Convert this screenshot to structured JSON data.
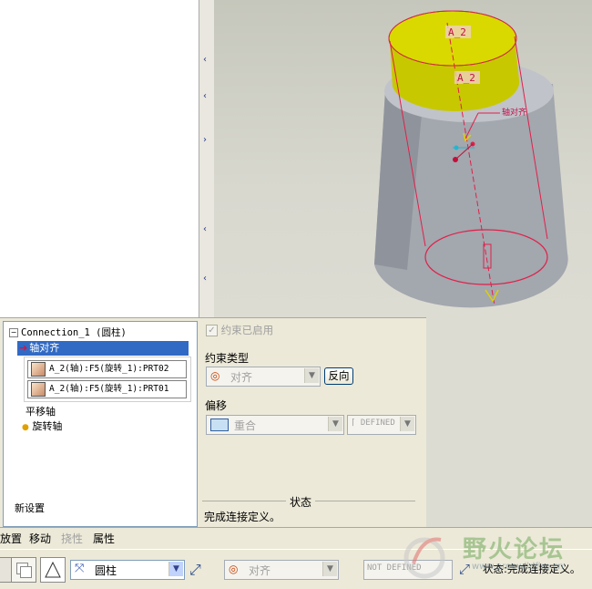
{
  "viewport": {
    "axis_label_top": "A_2",
    "axis_label_mid": "A_2",
    "constraint_label": "轴对齐"
  },
  "tree": {
    "connection": "Connection_1 (圆柱)",
    "axis_align": "轴对齐",
    "ref1": "A_2(轴):F5(旋转_1):PRT02",
    "ref2": "A_2(轴):F5(旋转_1):PRT01",
    "translate_axis": "平移轴",
    "rotate_axis": "旋转轴",
    "new_set": "新设置"
  },
  "props": {
    "enabled_label": "约束已启用",
    "type_label": "约束类型",
    "type_value": "对齐",
    "flip_button": "反向",
    "offset_label": "偏移",
    "offset_value": "重合",
    "offset_state": "DEFINED",
    "status_title": "状态",
    "status_text": "完成连接定义。"
  },
  "tabs": [
    "放置",
    "移动",
    "挠性",
    "属性"
  ],
  "toolbar": {
    "connection_type": "圆柱",
    "constraint_value": "对齐",
    "not_defined": "NOT DEFINED",
    "status": "状态:完成连接定义。"
  },
  "watermark": {
    "title": "野火论坛",
    "url": "www.proewildfire.cn"
  },
  "colors": {
    "selection": "#316ac5",
    "panel": "#ece9d8",
    "cylinder_top": "#d4d400",
    "cylinder_body": "#a3a7ae",
    "constraint": "#e0204a"
  }
}
